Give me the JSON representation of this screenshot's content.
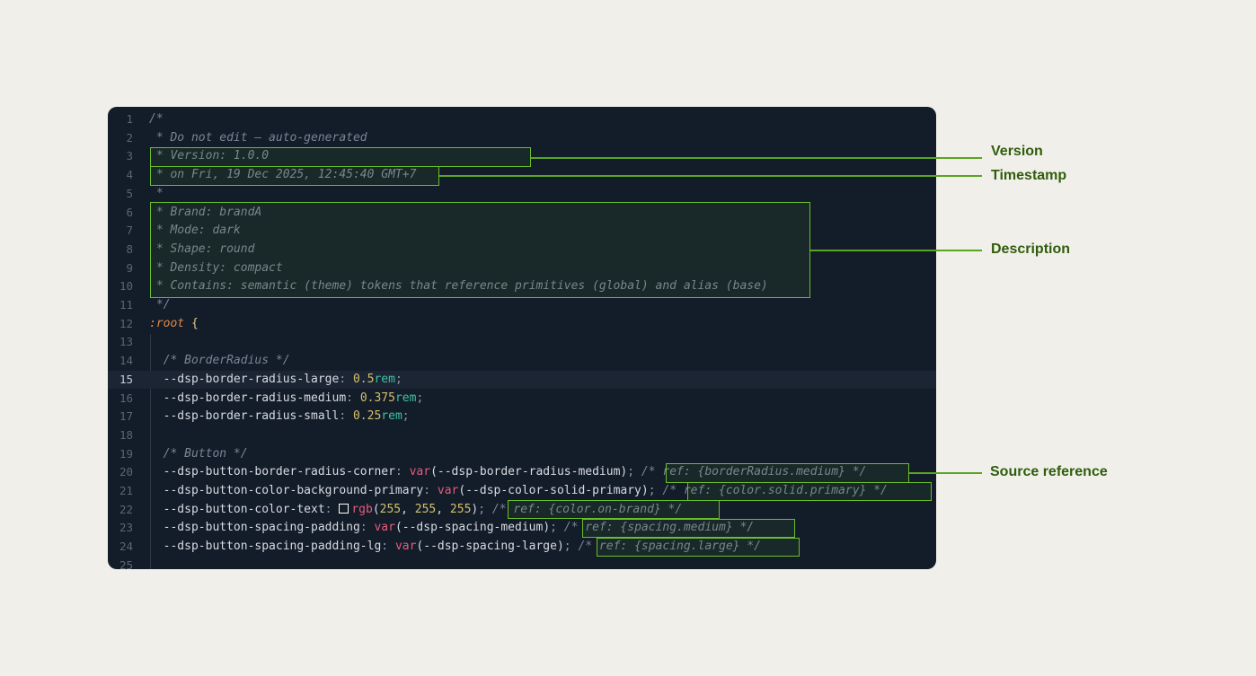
{
  "editor": {
    "lines": [
      {
        "n": "1",
        "segs": [
          {
            "t": "/*",
            "c": "c"
          }
        ]
      },
      {
        "n": "2",
        "segs": [
          {
            "t": " * Do not edit — auto-generated",
            "c": "c"
          }
        ]
      },
      {
        "n": "3",
        "segs": [
          {
            "t": " * Version: 1.0.0",
            "c": "c"
          }
        ]
      },
      {
        "n": "4",
        "segs": [
          {
            "t": " * on Fri, 19 Dec 2025, 12:45:40 GMT+7",
            "c": "c"
          }
        ]
      },
      {
        "n": "5",
        "segs": [
          {
            "t": " *",
            "c": "c"
          }
        ]
      },
      {
        "n": "6",
        "segs": [
          {
            "t": " * Brand: brandA",
            "c": "c"
          }
        ]
      },
      {
        "n": "7",
        "segs": [
          {
            "t": " * Mode: dark",
            "c": "c"
          }
        ]
      },
      {
        "n": "8",
        "segs": [
          {
            "t": " * Shape: round",
            "c": "c"
          }
        ]
      },
      {
        "n": "9",
        "segs": [
          {
            "t": " * Density: compact",
            "c": "c"
          }
        ]
      },
      {
        "n": "10",
        "segs": [
          {
            "t": " * Contains: semantic (theme) tokens that reference primitives (global) and alias (base)",
            "c": "c"
          }
        ]
      },
      {
        "n": "11",
        "segs": [
          {
            "t": " */",
            "c": "c"
          }
        ]
      },
      {
        "n": "12",
        "segs": [
          {
            "t": ":root",
            "c": "sel"
          },
          {
            "t": " ",
            "c": "p"
          },
          {
            "t": "{",
            "c": "br"
          }
        ]
      },
      {
        "n": "13",
        "segs": []
      },
      {
        "n": "14",
        "segs": [
          {
            "t": "  /* BorderRadius */",
            "c": "c"
          }
        ]
      },
      {
        "n": "15",
        "active": true,
        "segs": [
          {
            "t": "  --dsp-border-radius-large",
            "c": "prop"
          },
          {
            "t": ": ",
            "c": "punc"
          },
          {
            "t": "0.5",
            "c": "num"
          },
          {
            "t": "rem",
            "c": "unit"
          },
          {
            "t": ";",
            "c": "punc"
          }
        ]
      },
      {
        "n": "16",
        "segs": [
          {
            "t": "  --dsp-border-radius-medium",
            "c": "prop"
          },
          {
            "t": ": ",
            "c": "punc"
          },
          {
            "t": "0.375",
            "c": "num"
          },
          {
            "t": "rem",
            "c": "unit"
          },
          {
            "t": ";",
            "c": "punc"
          }
        ]
      },
      {
        "n": "17",
        "segs": [
          {
            "t": "  --dsp-border-radius-small",
            "c": "prop"
          },
          {
            "t": ": ",
            "c": "punc"
          },
          {
            "t": "0.25",
            "c": "num"
          },
          {
            "t": "rem",
            "c": "unit"
          },
          {
            "t": ";",
            "c": "punc"
          }
        ]
      },
      {
        "n": "18",
        "segs": []
      },
      {
        "n": "19",
        "segs": [
          {
            "t": "  /* Button */",
            "c": "c"
          }
        ]
      },
      {
        "n": "20",
        "segs": [
          {
            "t": "  --dsp-button-border-radius-corner",
            "c": "prop"
          },
          {
            "t": ": ",
            "c": "punc"
          },
          {
            "t": "var",
            "c": "fn"
          },
          {
            "t": "(--dsp-border-radius-medium)",
            "c": "p"
          },
          {
            "t": "; ",
            "c": "punc"
          },
          {
            "t": "/* ref: {borderRadius.medium} */",
            "c": "c"
          }
        ]
      },
      {
        "n": "21",
        "segs": [
          {
            "t": "  --dsp-button-color-background-primary",
            "c": "prop"
          },
          {
            "t": ": ",
            "c": "punc"
          },
          {
            "t": "var",
            "c": "fn"
          },
          {
            "t": "(--dsp-color-solid-primary)",
            "c": "p"
          },
          {
            "t": "; ",
            "c": "punc"
          },
          {
            "t": "/* ref: {color.solid.primary} */",
            "c": "c"
          }
        ]
      },
      {
        "n": "22",
        "segs": [
          {
            "t": "  --dsp-button-color-text",
            "c": "prop"
          },
          {
            "t": ": ",
            "c": "punc"
          },
          {
            "t": "",
            "c": "swatch"
          },
          {
            "t": "rgb",
            "c": "fn"
          },
          {
            "t": "(",
            "c": "p"
          },
          {
            "t": "255",
            "c": "num"
          },
          {
            "t": ", ",
            "c": "p"
          },
          {
            "t": "255",
            "c": "num"
          },
          {
            "t": ", ",
            "c": "p"
          },
          {
            "t": "255",
            "c": "num"
          },
          {
            "t": ")",
            "c": "p"
          },
          {
            "t": "; ",
            "c": "punc"
          },
          {
            "t": "/* ref: {color.on-brand} */",
            "c": "c"
          }
        ]
      },
      {
        "n": "23",
        "segs": [
          {
            "t": "  --dsp-button-spacing-padding",
            "c": "prop"
          },
          {
            "t": ": ",
            "c": "punc"
          },
          {
            "t": "var",
            "c": "fn"
          },
          {
            "t": "(--dsp-spacing-medium)",
            "c": "p"
          },
          {
            "t": "; ",
            "c": "punc"
          },
          {
            "t": "/* ref: {spacing.medium} */",
            "c": "c"
          }
        ]
      },
      {
        "n": "24",
        "segs": [
          {
            "t": "  --dsp-button-spacing-padding-lg",
            "c": "prop"
          },
          {
            "t": ": ",
            "c": "punc"
          },
          {
            "t": "var",
            "c": "fn"
          },
          {
            "t": "(--dsp-spacing-large)",
            "c": "p"
          },
          {
            "t": "; ",
            "c": "punc"
          },
          {
            "t": "/* ref: {spacing.large} */",
            "c": "c"
          }
        ]
      },
      {
        "n": "25",
        "segs": []
      }
    ]
  },
  "callouts": {
    "version": "Version",
    "timestamp": "Timestamp",
    "description": "Description",
    "source_reference": "Source reference"
  },
  "colors": {
    "accent": "#6bbd2c",
    "background": "#f1efea",
    "editor_bg": "#131c29"
  }
}
